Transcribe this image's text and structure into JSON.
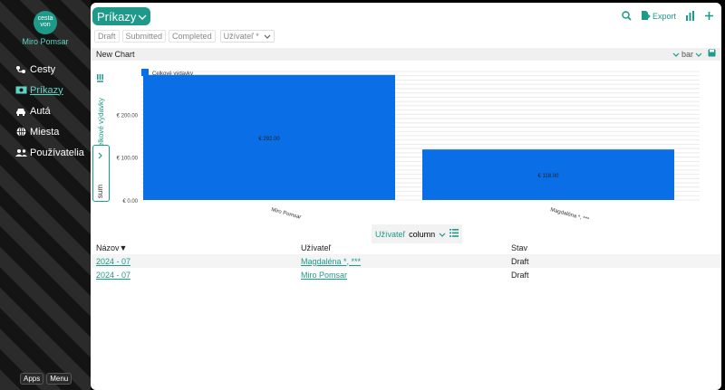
{
  "sidebar": {
    "logo_top": "cesta",
    "logo_bottom": "von",
    "user_name": "Miro Pomsar",
    "items": [
      {
        "label": "Cesty",
        "icon": "route-icon",
        "active": false
      },
      {
        "label": "Príkazy",
        "icon": "money-icon",
        "active": true
      },
      {
        "label": "Autá",
        "icon": "car-icon",
        "active": false
      },
      {
        "label": "Miesta",
        "icon": "globe-icon",
        "active": false
      },
      {
        "label": "Používatelia",
        "icon": "users-icon",
        "active": false
      }
    ],
    "apps_label": "Apps",
    "menu_label": "Menu"
  },
  "header": {
    "title": "Príkazy",
    "export_label": "Export"
  },
  "filters": {
    "chips": [
      "Draft",
      "Submitted",
      "Completed"
    ],
    "user_select": "Užívateľ *"
  },
  "chart_header": {
    "name": "New Chart",
    "type_label": "bar"
  },
  "vertical": {
    "measure_label": "Celkové výdavky",
    "agg_label": "sum"
  },
  "chart_data": {
    "type": "bar",
    "categories": [
      "Miro Pomsar",
      "Magdaléna *, ***"
    ],
    "series": [
      {
        "name": "Celkové výdavky",
        "values": [
          292,
          118
        ]
      }
    ],
    "value_labels": [
      "€ 292.00",
      "€ 118.00"
    ],
    "ylim": [
      0,
      300
    ],
    "yticks": [
      0,
      100,
      200
    ],
    "ytick_labels": [
      "€ 0.00",
      "€ 100.00",
      "€ 200.00"
    ],
    "legend": "top-left",
    "grid": true,
    "colors": {
      "bar": "#0a6fe6"
    }
  },
  "group_bar": {
    "field": "Užívateľ",
    "mode": "column"
  },
  "table": {
    "headers": [
      "Názov▼",
      "Užívateľ",
      "Stav"
    ],
    "rows": [
      [
        "2024 - 07",
        "Magdaléna *, ***",
        "Draft"
      ],
      [
        "2024 - 07",
        "Miro Pomsar",
        "Draft"
      ]
    ]
  },
  "colors": {
    "accent": "#1d9a8a",
    "chart_bar": "#0a6fe6"
  }
}
